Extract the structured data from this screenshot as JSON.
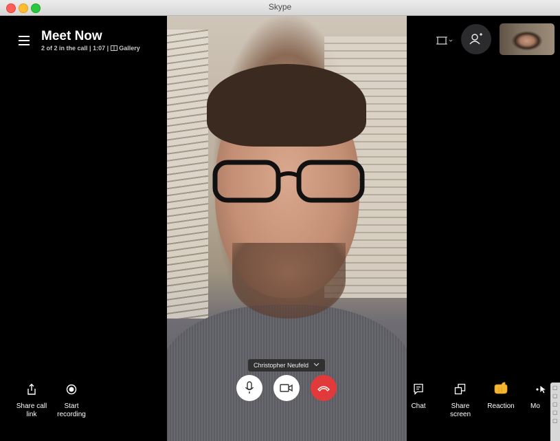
{
  "window": {
    "title": "Skype"
  },
  "call": {
    "title": "Meet Now",
    "participants": "2 of 2 in the call",
    "separator": "|",
    "duration": "1:07",
    "view_mode": "Gallery"
  },
  "speaker": {
    "name": "Christopher Neufeld"
  },
  "left_controls": [
    {
      "label_line1": "Share call",
      "label_line2": "link",
      "icon": "share-icon"
    },
    {
      "label_line1": "Start",
      "label_line2": "recording",
      "icon": "record-icon"
    }
  ],
  "center_controls": {
    "mic": "microphone-icon",
    "camera": "video-camera-icon",
    "hangup": "hang-up-icon"
  },
  "right_controls": [
    {
      "label_line1": "Chat",
      "label_line2": "",
      "icon": "chat-icon"
    },
    {
      "label_line1": "Share",
      "label_line2": "screen",
      "icon": "share-screen-icon"
    },
    {
      "label_line1": "Reaction",
      "label_line2": "",
      "icon": "reaction-hand-icon"
    },
    {
      "label_line1": "Mo",
      "label_line2": "",
      "icon": "more-icon"
    }
  ],
  "colors": {
    "hangup": "#e23a3a",
    "background": "#000000",
    "reaction": "#f5b731"
  }
}
